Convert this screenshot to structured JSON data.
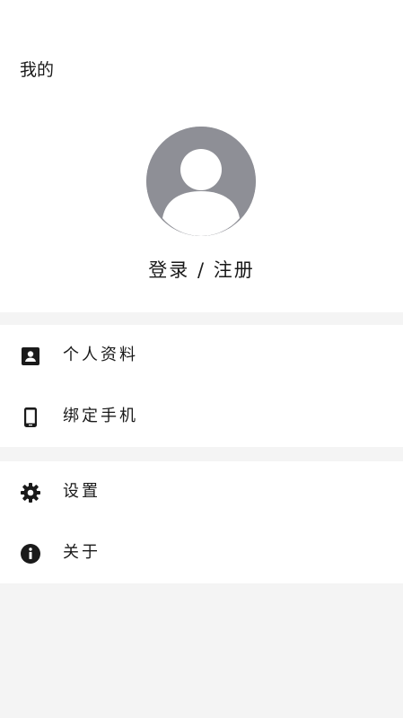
{
  "header": {
    "title": "我的"
  },
  "profile": {
    "avatar_icon": "avatar-placeholder-icon",
    "login_label": "登录 / 注册",
    "avatar_color": "#8e8f96"
  },
  "menu_groups": [
    {
      "items": [
        {
          "label": "个人资料",
          "icon": "contact-card-icon"
        },
        {
          "label": "绑定手机",
          "icon": "phone-icon"
        }
      ]
    },
    {
      "items": [
        {
          "label": "设置",
          "icon": "gear-icon"
        },
        {
          "label": "关于",
          "icon": "info-icon"
        }
      ]
    }
  ],
  "colors": {
    "background": "#f4f4f4",
    "surface": "#ffffff",
    "text": "#1a1a1a"
  }
}
